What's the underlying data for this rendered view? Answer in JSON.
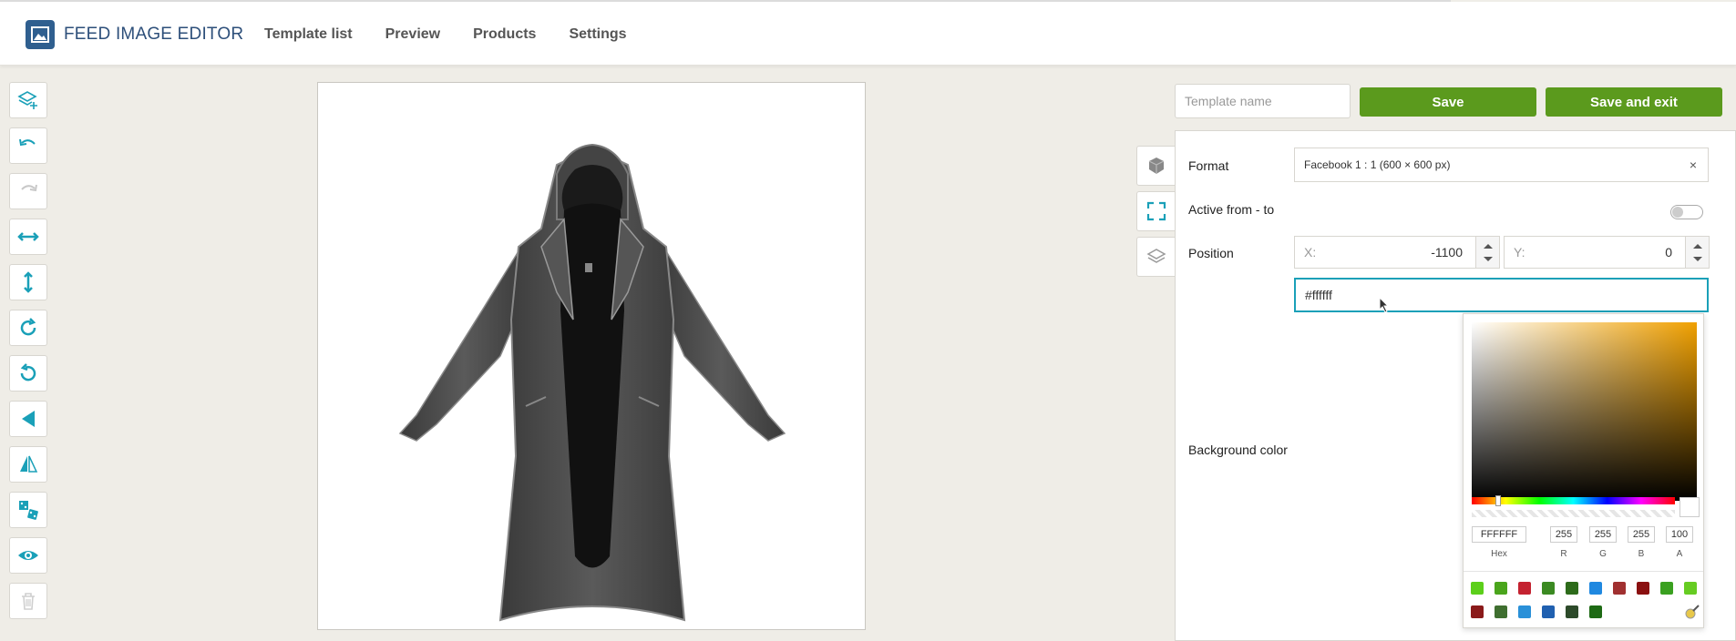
{
  "header": {
    "app_title": "FEED IMAGE EDITOR",
    "nav": [
      "Template list",
      "Preview",
      "Products",
      "Settings"
    ]
  },
  "toolbar": {
    "tools": [
      "add-layer-icon",
      "undo-icon",
      "redo-icon",
      "stretch-horizontal-icon",
      "stretch-vertical-icon",
      "rotate-clockwise-icon",
      "rotate-counterclockwise-icon",
      "flip-horizontal-icon",
      "mirror-icon",
      "randomize-icon",
      "visibility-icon",
      "delete-icon"
    ]
  },
  "actions": {
    "template_name_placeholder": "Template name",
    "save_label": "Save",
    "save_exit_label": "Save and exit"
  },
  "panel": {
    "format_label": "Format",
    "format_value": "Facebook 1 : 1 (600 × 600 px)",
    "format_clear": "×",
    "active_label": "Active from - to",
    "position_label": "Position",
    "x_label": "X:",
    "x_value": "-1100",
    "y_label": "Y:",
    "y_value": "0",
    "color_value": "#ffffff",
    "background_label": "Background color"
  },
  "picker": {
    "hex": "FFFFFF",
    "r": "255",
    "g": "255",
    "b": "255",
    "a": "100",
    "labels": {
      "hex": "Hex",
      "r": "R",
      "g": "G",
      "b": "B",
      "a": "A"
    },
    "swatches": [
      "#5ccf1a",
      "#4aa51c",
      "#c42230",
      "#3b8a22",
      "#2d6b1a",
      "#1f88e0",
      "#a03030",
      "#8a1010",
      "#3aa020",
      "#66cc22",
      "#8a1a1a",
      "#3f6f30",
      "#2a90d8",
      "#2060b0",
      "#2d4a2a",
      "#1e6a14"
    ]
  },
  "colors": {
    "accent": "#1aa0b8",
    "save_green": "#5b9a1d",
    "brand": "#2f5f8f"
  }
}
